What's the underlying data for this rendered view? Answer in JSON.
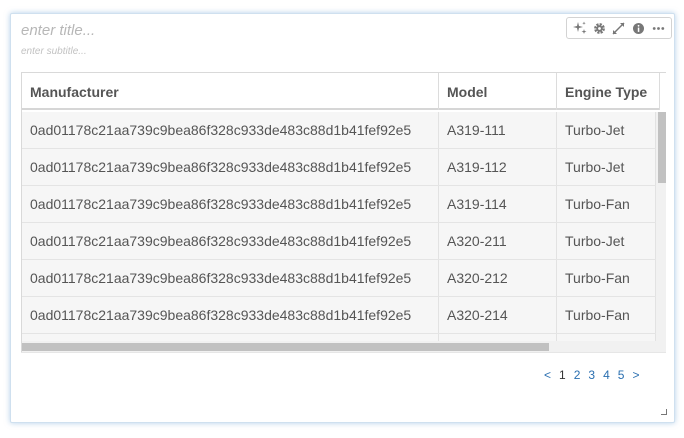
{
  "widget": {
    "title_placeholder": "enter title...",
    "subtitle_placeholder": "enter subtitle..."
  },
  "toolbar": {
    "icons": [
      "sparkle-icon",
      "gear-icon",
      "expand-icon",
      "info-icon",
      "more-icon"
    ]
  },
  "table": {
    "columns": [
      "Manufacturer",
      "Model",
      "Engine Type"
    ],
    "rows": [
      {
        "manufacturer": "0ad01178c21aa739c9bea86f328c933de483c88d1b41fef92e5",
        "model": "A319-111",
        "engine": "Turbo-Jet"
      },
      {
        "manufacturer": "0ad01178c21aa739c9bea86f328c933de483c88d1b41fef92e5",
        "model": "A319-112",
        "engine": "Turbo-Jet"
      },
      {
        "manufacturer": "0ad01178c21aa739c9bea86f328c933de483c88d1b41fef92e5",
        "model": "A319-114",
        "engine": "Turbo-Fan"
      },
      {
        "manufacturer": "0ad01178c21aa739c9bea86f328c933de483c88d1b41fef92e5",
        "model": "A320-211",
        "engine": "Turbo-Jet"
      },
      {
        "manufacturer": "0ad01178c21aa739c9bea86f328c933de483c88d1b41fef92e5",
        "model": "A320-212",
        "engine": "Turbo-Fan"
      },
      {
        "manufacturer": "0ad01178c21aa739c9bea86f328c933de483c88d1b41fef92e5",
        "model": "A320-214",
        "engine": "Turbo-Fan"
      },
      {
        "manufacturer": "",
        "model": "",
        "engine": ""
      }
    ]
  },
  "pagination": {
    "prev": "<",
    "next": ">",
    "current": "1",
    "pages": [
      "1",
      "2",
      "3",
      "4",
      "5"
    ]
  },
  "colors": {
    "widget_border": "#cfe0ef",
    "link": "#2a6fb0",
    "row_bg": "#f6f6f6"
  }
}
